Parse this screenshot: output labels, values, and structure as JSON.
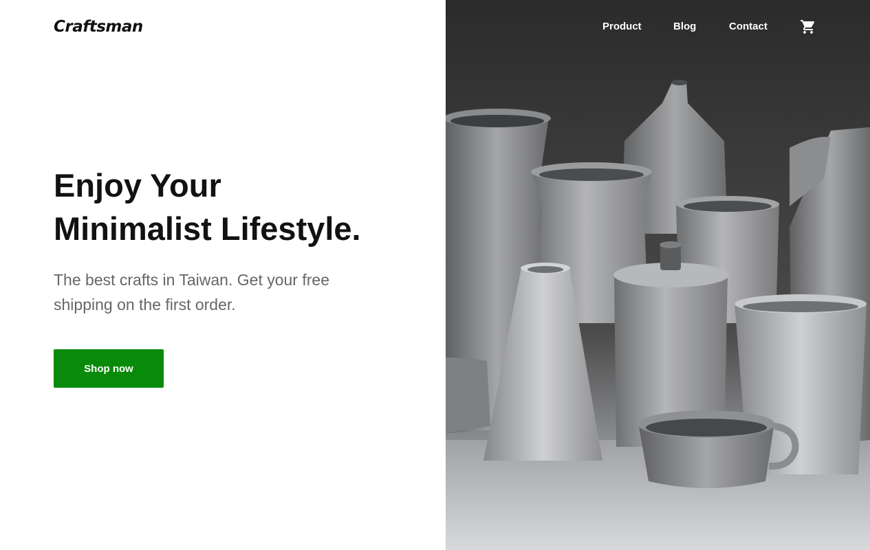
{
  "brand": {
    "name": "Craftsman"
  },
  "nav": {
    "items": [
      {
        "label": "Product"
      },
      {
        "label": "Blog"
      },
      {
        "label": "Contact"
      }
    ],
    "cart_icon": "shopping-cart-icon"
  },
  "hero": {
    "title_line1": "Enjoy Your",
    "title_line2": "Minimalist Lifestyle.",
    "subtitle": "The best crafts in Taiwan. Get your free shipping on the first order.",
    "cta_label": "Shop now",
    "image_subject": "grey ceramic vases and cups"
  },
  "colors": {
    "accent": "#0a8a0a",
    "text_dark": "#121212",
    "text_muted": "#666666",
    "nav_text": "#ffffff"
  }
}
